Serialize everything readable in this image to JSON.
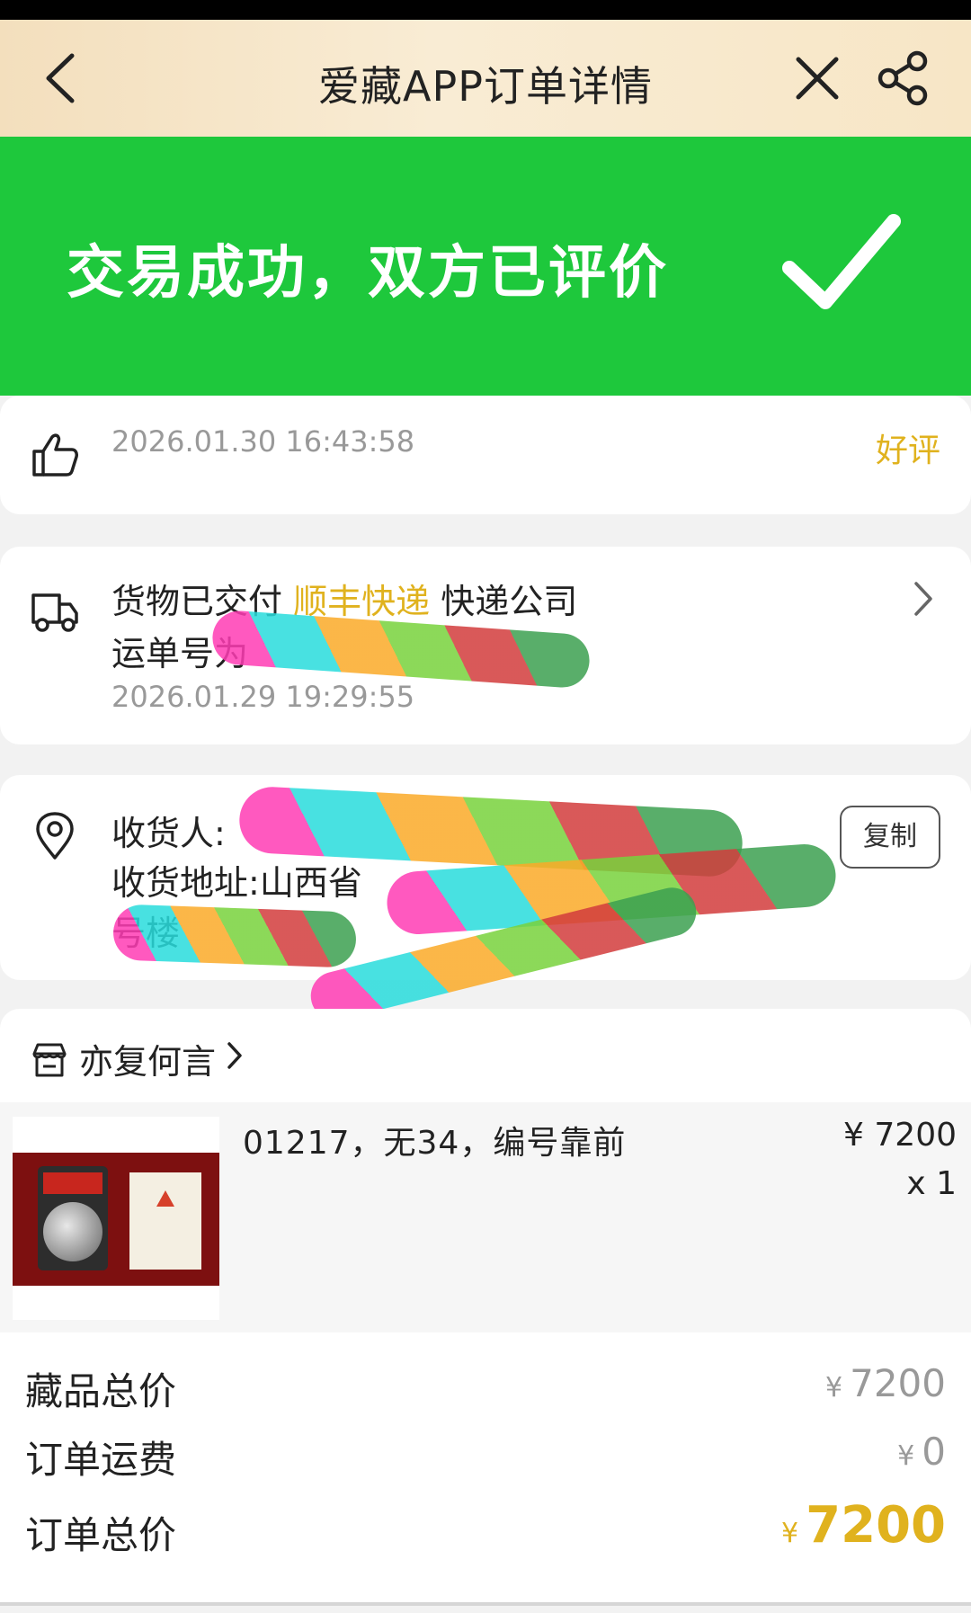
{
  "nav": {
    "title": "爱藏APP订单详情",
    "background": "#f3dfbd"
  },
  "status_banner": {
    "text": "交易成功，双方已评价",
    "color": "#1ec83c",
    "icon": "checkmark-icon"
  },
  "rating": {
    "time": "2026.01.30 16:43:58",
    "result": "好评",
    "icon": "thumbs-up-icon"
  },
  "shipping": {
    "prefix": "货物已交付",
    "courier": "顺丰快递",
    "suffix": "快递公司",
    "tracking_label": "运单号为",
    "time": "2026.01.29 19:29:55",
    "icon": "truck-icon"
  },
  "address": {
    "receiver_label": "收货人:",
    "address_label": "收货地址:",
    "address_visible": "山西省",
    "address_line2_visible": "号楼",
    "copy_label": "复制",
    "icon": "location-pin-icon"
  },
  "shop": {
    "name": "亦复何言",
    "icon": "store-icon"
  },
  "product": {
    "title": "01217，无34，编号靠前",
    "price": "¥ 7200",
    "quantity": "x 1"
  },
  "totals": {
    "items_label": "藏品总价",
    "items_currency": "¥",
    "items_value": "7200",
    "shipping_label": "订单运费",
    "shipping_currency": "¥",
    "shipping_value": "0",
    "order_label": "订单总价",
    "order_currency": "¥",
    "order_value": "7200",
    "accent_color": "#e0b21e"
  }
}
